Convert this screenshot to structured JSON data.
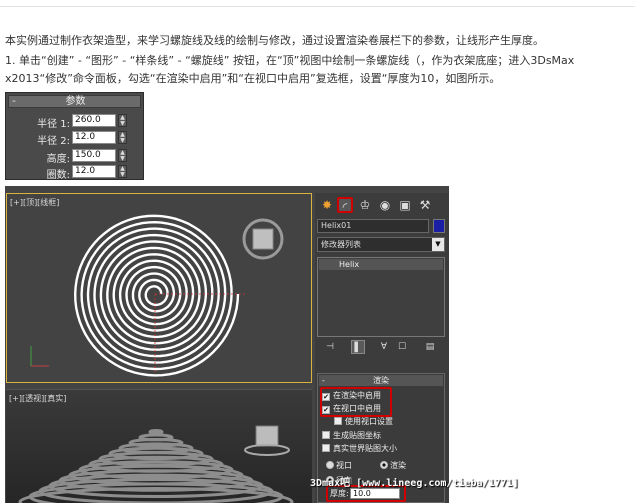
{
  "article": {
    "p1": "本实例通过制作衣架造型，来学习螺旋线及线的绘制与修改，通过设置渲染卷展栏下的参数，让线形产生厚度。",
    "p2": "1. 单击“创建” - “图形” - “样条线” - “螺旋线” 按钮，在“顶”视图中绘制一条螺旋线（，作为衣架底座；进入3DsMax",
    "p3": "x2013“修改”命令面板，勾选“在渲染中启用”和“在视口中启用”复选框，设置“厚度为10，如图所示。"
  },
  "params_panel": {
    "title": "参数",
    "rows": [
      {
        "label": "半径 1:",
        "value": "260.0"
      },
      {
        "label": "半径 2:",
        "value": "12.0"
      },
      {
        "label": "高度:",
        "value": "150.0"
      },
      {
        "label": "圈数:",
        "value": "12.0"
      }
    ]
  },
  "viewport_top": {
    "label": "[+][顶][线框]"
  },
  "viewport_persp": {
    "label": "[+][透视][真实]"
  },
  "command_panel": {
    "object_name": "Helix01",
    "object_color": "#1a1fa5",
    "modifier_list": "修改器列表",
    "stack_item": "Helix",
    "render_rollout": {
      "title": "渲染",
      "enable_in_render": "在渲染中启用",
      "enable_in_viewport": "在视口中启用",
      "use_viewport_settings": "使用视口设置",
      "gen_mapping": "生成贴图坐标",
      "real_world_size": "真实世界贴图大小",
      "viewport_radio": "视口",
      "render_radio": "渲染",
      "radial_radio": "径向",
      "thickness_label": "厚度:",
      "thickness_value": "10.0"
    }
  },
  "watermark": "3Dmax吧 [www.lineeg.com/tieba/1771]",
  "colors": {
    "highlight": "#d00000",
    "viewport_border": "#d7b441"
  }
}
